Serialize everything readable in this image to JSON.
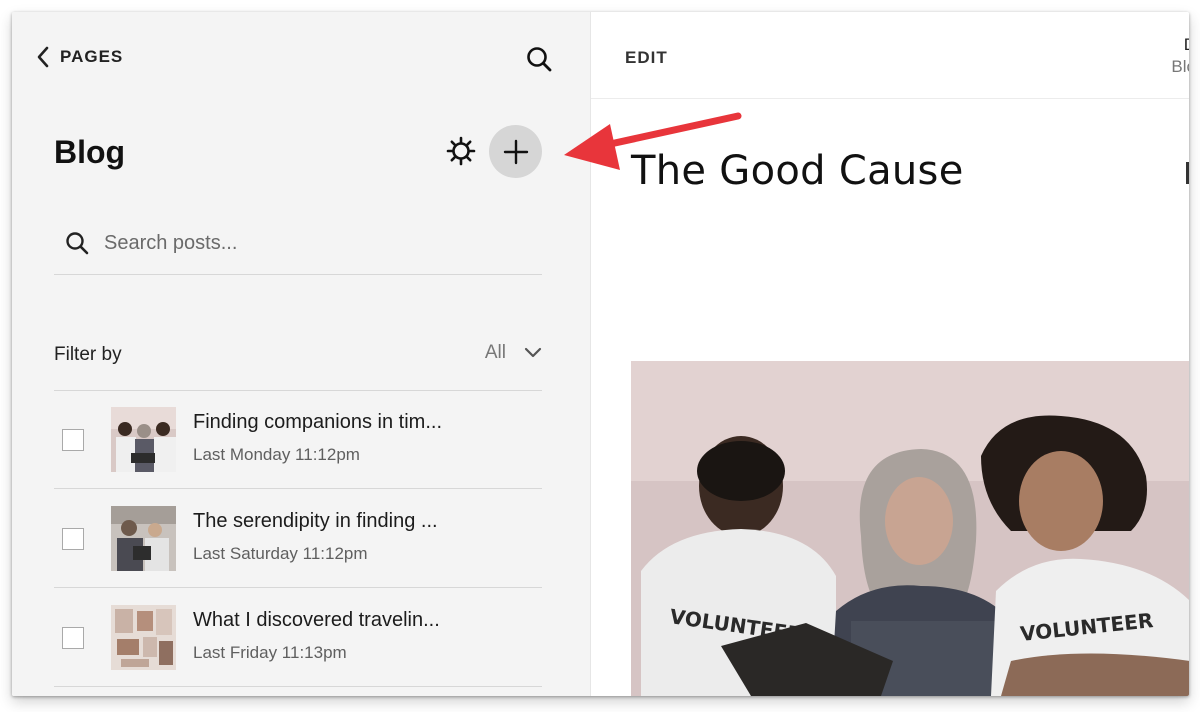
{
  "sidebar": {
    "back_label": "PAGES",
    "title": "Blog",
    "search": {
      "placeholder": "Search posts..."
    },
    "filter": {
      "label": "Filter by",
      "value": "All"
    },
    "posts": [
      {
        "title": "Finding companions in tim...",
        "date": "Last Monday 11:12pm"
      },
      {
        "title": "The serendipity in finding ...",
        "date": "Last Saturday 11:12pm"
      },
      {
        "title": "What I discovered travelin...",
        "date": "Last Friday 11:13pm"
      }
    ]
  },
  "preview": {
    "edit_label": "EDIT",
    "top_right_line1": "D",
    "top_right_line2": "Blo",
    "site_title": "The Good Cause",
    "hero_shirt_text_left": "VOLUNTEER",
    "hero_shirt_text_right": "VOLUNTEER"
  },
  "annotation": {
    "arrow_color": "#e8353b"
  },
  "colors": {
    "sidebar_bg": "#f4f4f4",
    "add_button_bg": "#d6d6d6",
    "text": "#111111"
  },
  "icons": [
    "chevron-left-icon",
    "search-icon",
    "gear-icon",
    "plus-icon",
    "chevron-down-icon"
  ]
}
